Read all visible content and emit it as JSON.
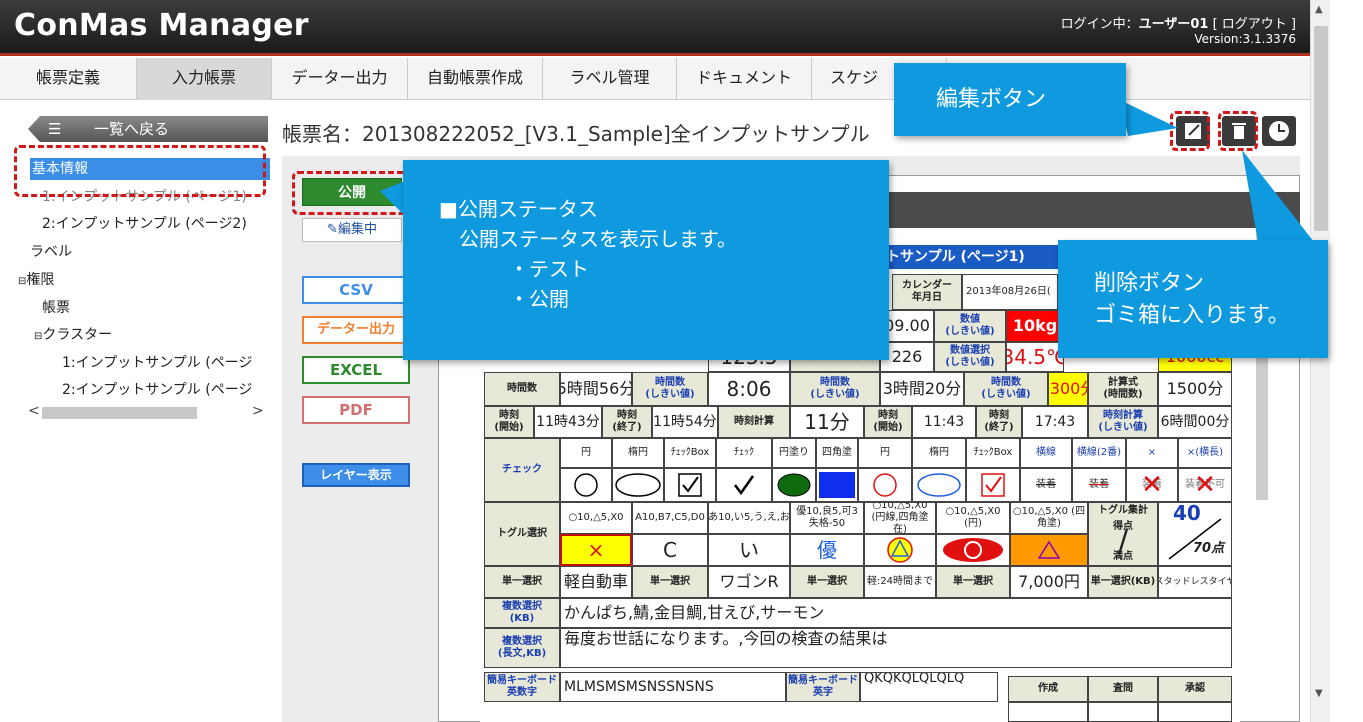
{
  "app": {
    "title": "ConMas Manager",
    "login_prefix": "ログイン中：",
    "user": "ユーザー01",
    "logout": "[ ログアウト ]",
    "version": "Version:3.1.3376"
  },
  "nav": {
    "tabs": [
      {
        "label": "帳票定義"
      },
      {
        "label": "入力帳票"
      },
      {
        "label": "データー出力"
      },
      {
        "label": "自動帳票作成"
      },
      {
        "label": "ラベル管理"
      },
      {
        "label": "ドキュメント"
      },
      {
        "label": "スケジ"
      }
    ]
  },
  "sidebar": {
    "back_label": "一覧へ戻る",
    "tree": [
      {
        "label": "基本情報"
      },
      {
        "label": "1:インプットサンプル (ページ1)"
      },
      {
        "label": "2:インプットサンプル (ページ2)"
      },
      {
        "label": "ラベル"
      },
      {
        "label": "権限"
      },
      {
        "label": "帳票"
      },
      {
        "label": "クラスター"
      },
      {
        "label": "1:インプットサンプル (ページ"
      },
      {
        "label": "2:インプットサンプル (ページ"
      }
    ]
  },
  "main": {
    "form_title": "帳票名：201308222052_[V3.1_Sample]全インプットサンプル",
    "status_button": "公開",
    "edit_status": "編集中",
    "buttons": {
      "csv": "CSV",
      "data_output": "データー出力",
      "excel": "EXCEL",
      "pdf": "PDF",
      "layer": "レイヤー表示"
    },
    "sheet_title": "トサンプル (ページ1)"
  },
  "sheet": {
    "calendar_label": "カレンダー",
    "calendar_sub": "年月日",
    "calendar_value": "2013年08月26日(",
    "r1": {
      "v1": "09.00",
      "numeric_label": "数値",
      "threshold": "(しきい値)",
      "v_red": "10kg"
    },
    "r2": {
      "v0": "123.5",
      "sel_label": "(数値選択)",
      "v1": "226",
      "numsel_label": "数値選択",
      "v_temp": "34.5℃",
      "v_yellow": "1000cc"
    },
    "r3": {
      "label": "時間数",
      "v1": "5時間56分",
      "hours_label": "時間数",
      "v2": "8:06",
      "v3": "3時間20分",
      "v_yellow": "1300分",
      "calc_label": "計算式",
      "calc_sub": "(時間数)",
      "v4": "1500分"
    },
    "r4": {
      "time_label": "時刻",
      "start": "(開始)",
      "end": "(終了)",
      "v1": "11時43分",
      "v2": "11時54分",
      "calc_label": "時刻計算",
      "v3": "11分",
      "v4": "11:43",
      "v5": "17:43",
      "calc_label2": "時刻計算",
      "v6": "6時間00分"
    },
    "check": {
      "label": "チェック",
      "headers": [
        "円",
        "楕円",
        "ﾁｪｯｸBox",
        "ﾁｪｯｸ",
        "円塗り",
        "四角塗",
        "円",
        "楕円",
        "ﾁｪｯｸBox",
        "横線",
        "横線(2番)",
        "×",
        "×(横長)"
      ],
      "strike_labels": [
        "装着",
        "装着",
        "装着",
        "装着不可"
      ]
    },
    "toggle": {
      "label": "トグル選択",
      "opts": [
        "○10,△5,X0",
        "A10,B7,C5,D0",
        "あ10,い5,う,え,お",
        "優10,良5,可3 失格-50",
        "○10,△5,X0 (円線,四角塗在)",
        "○10,△5,X0 (円)",
        "○10,△5,X0 (四角塗)",
        "トグル集計"
      ],
      "values": [
        "×",
        "C",
        "い",
        "優"
      ],
      "score_label": "得点",
      "full_label": "満点",
      "score": "40",
      "full": "70点"
    },
    "single": {
      "label": "単一選択",
      "v1": "軽自動車",
      "v2": "ワゴンR",
      "v3": "軽:24時間まで",
      "v4": "7,000円",
      "kb_label": "単一選択(KB)",
      "v5": "スタッドレスタイヤ"
    },
    "multi": {
      "label": "複数選択",
      "sub": "(KB)",
      "value": "かんぱち,鯖,金目鯛,甘えび,サーモン"
    },
    "multi2": {
      "label": "複数選択",
      "sub": "(長文,KB)",
      "value": "毎度お世話になります。,今回の検査の結果は"
    },
    "kb": {
      "label": "簡易キーボード",
      "sub": "英数字",
      "value": "MLMSMSMSNSSNSNS",
      "label2": "簡易キーボード",
      "sub2": "英字",
      "value2": "QKQKQLQLQLQ"
    },
    "approval": [
      "作成",
      "査問",
      "承認"
    ]
  },
  "callouts": {
    "edit": "編集ボタン",
    "status_title": "■公開ステータス",
    "status_desc": "公開ステータスを表示します。",
    "status_item1": "・テスト",
    "status_item2": "・公開",
    "delete_title": "削除ボタン",
    "delete_desc": "ゴミ箱に入ります。"
  },
  "colors": {
    "accent": "#0f9ae0",
    "header": "#2a2a2a",
    "dash": "#d01818",
    "selected": "#3a8ee6",
    "public_green": "#2d8a2d"
  }
}
